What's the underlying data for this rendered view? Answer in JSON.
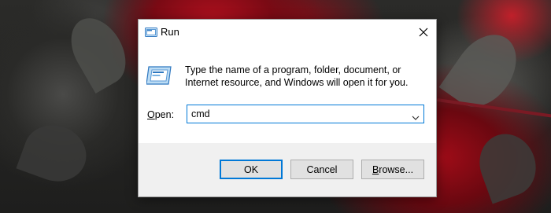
{
  "dialog": {
    "title": "Run",
    "icon": "run-icon",
    "close_icon": "close-icon",
    "description": "Type the name of a program, folder, document, or Internet resource, and Windows will open it for you.",
    "open_label": "Open:",
    "open_label_mnemonic": "O",
    "open_label_rest": "pen:",
    "input_value": "cmd",
    "dropdown_icon": "chevron-down-icon"
  },
  "buttons": {
    "ok": "OK",
    "cancel": "Cancel",
    "browse": "Browse...",
    "browse_mnemonic": "B",
    "browse_rest": "rowse..."
  },
  "colors": {
    "accent": "#0078d7",
    "footer_bg": "#f0f0f0",
    "button_bg": "#e1e1e1"
  }
}
